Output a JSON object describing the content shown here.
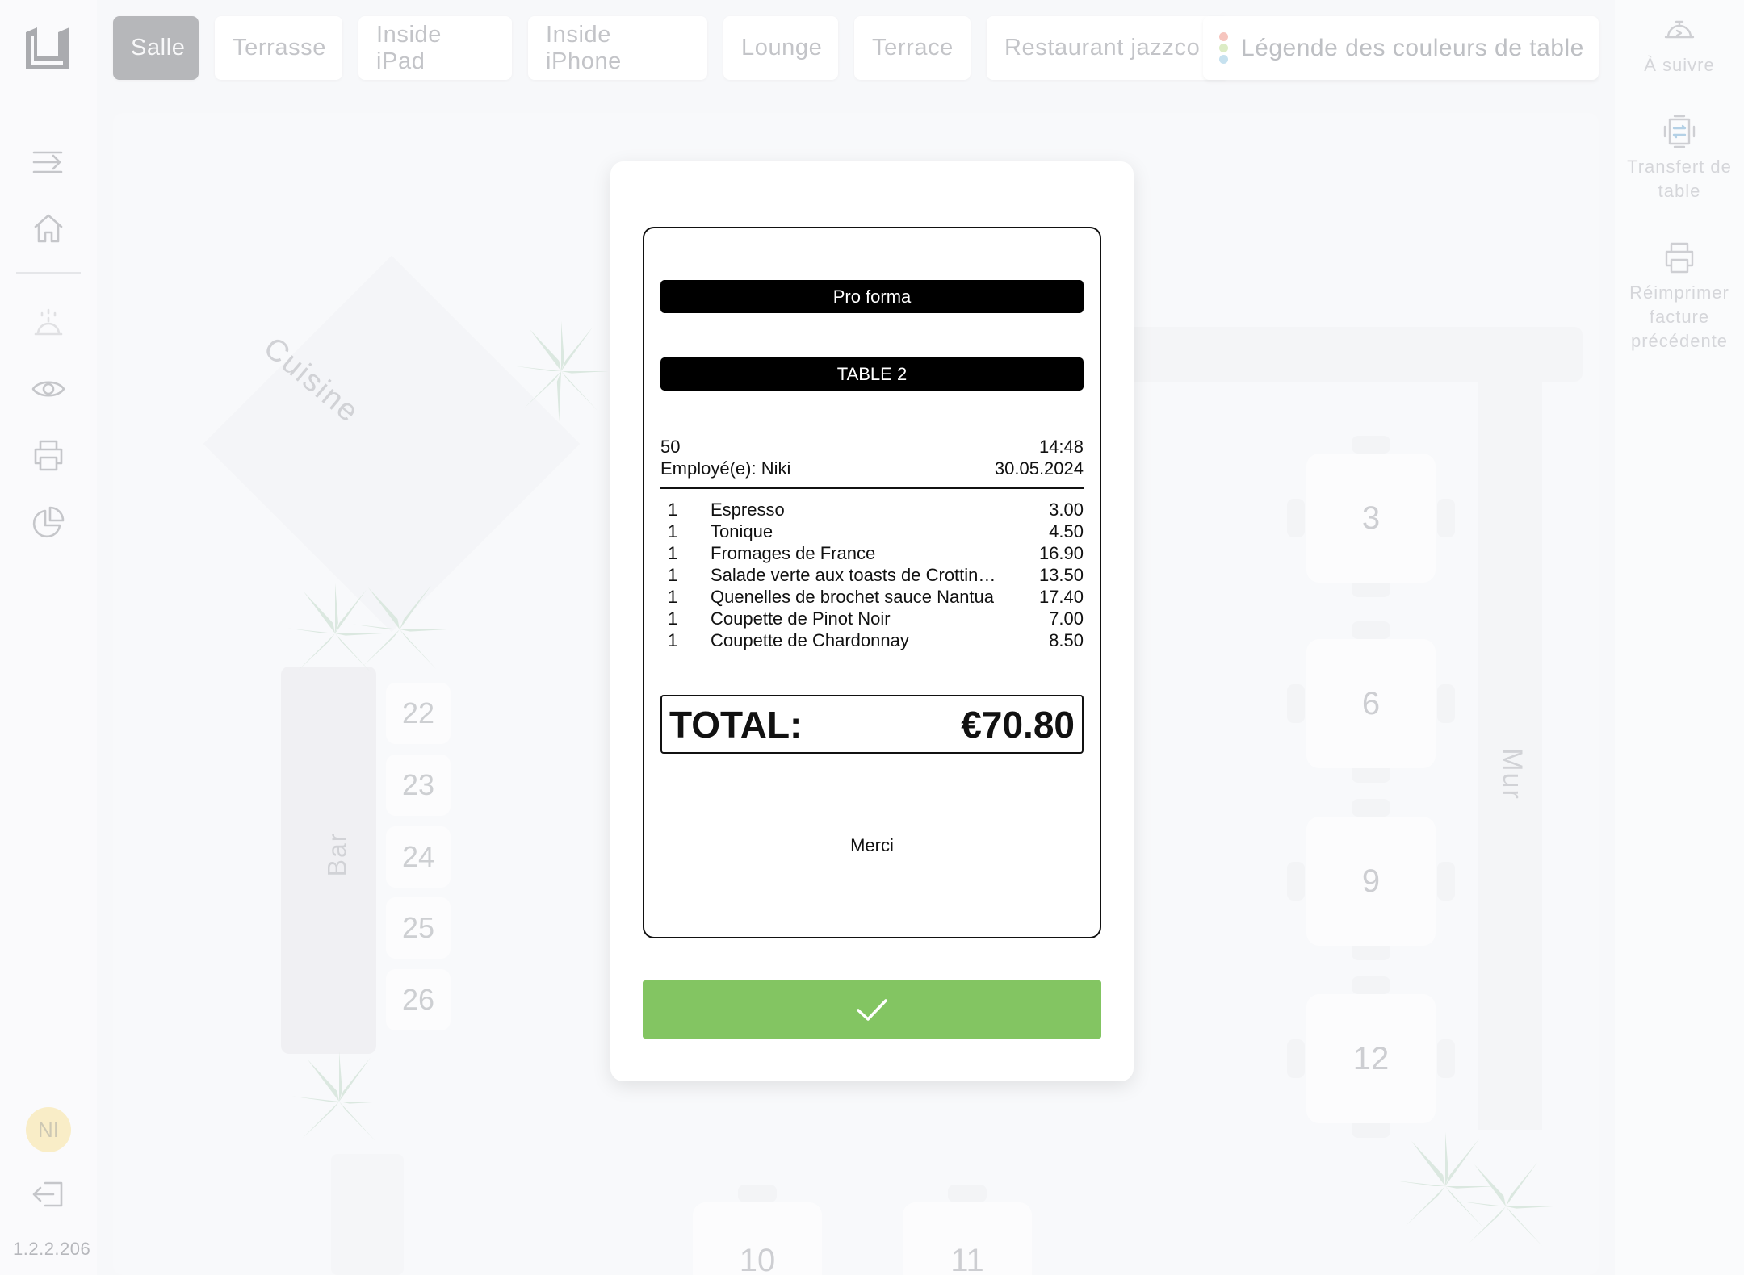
{
  "sidebar": {
    "version": "1.2.2.206",
    "avatar_initials": "NI",
    "icons": [
      "logo-icon",
      "collapse-menu-icon",
      "home-icon",
      "service-bell-icon",
      "eye-icon",
      "printer-icon",
      "pie-chart-icon",
      "logout-icon"
    ]
  },
  "tabs": [
    {
      "label": "Salle",
      "active": true
    },
    {
      "label": "Terrasse",
      "active": false
    },
    {
      "label": "Inside iPad",
      "active": false
    },
    {
      "label": "Inside iPhone",
      "active": false
    },
    {
      "label": "Lounge",
      "active": false
    },
    {
      "label": "Terrace",
      "active": false
    },
    {
      "label": "Restaurant jazzco",
      "active": false
    }
  ],
  "legend": {
    "label": "Légende des couleurs de table",
    "dot_colors": [
      "#f2a79c",
      "#c9e2a6",
      "#a8d2e6"
    ]
  },
  "right_actions": [
    {
      "label": "À suivre",
      "icon": "service-bell-arrow-icon"
    },
    {
      "label": "Transfert de table",
      "icon": "table-transfer-icon"
    },
    {
      "label": "Réimprimer facture précédente",
      "icon": "printer-icon"
    }
  ],
  "floor": {
    "kitchen_label": "Cuisine",
    "bar_label": "Bar",
    "wall_label": "Mur",
    "stools": [
      "22",
      "23",
      "24",
      "25",
      "26"
    ],
    "tables": [
      "3",
      "6",
      "9",
      "12"
    ],
    "bottom_tables": [
      "10",
      "11"
    ]
  },
  "receipt": {
    "title": "Pro forma",
    "table": "TABLE 2",
    "number": "50",
    "time": "14:48",
    "employee": "Employé(e): Niki",
    "date": "30.05.2024",
    "items": [
      {
        "qty": "1",
        "name": "Espresso",
        "price": "3.00"
      },
      {
        "qty": "1",
        "name": "Tonique",
        "price": "4.50"
      },
      {
        "qty": "1",
        "name": "Fromages de France",
        "price": "16.90"
      },
      {
        "qty": "1",
        "name": "Salade verte aux toasts de Crottin de Chavignol",
        "price": "13.50"
      },
      {
        "qty": "1",
        "name": "Quenelles de brochet sauce Nantua",
        "price": "17.40"
      },
      {
        "qty": "1",
        "name": "Coupette de Pinot Noir",
        "price": "7.00"
      },
      {
        "qty": "1",
        "name": "Coupette de Chardonnay",
        "price": "8.50"
      }
    ],
    "total_label": "TOTAL:",
    "total_value": "€70.80",
    "footer": "Merci"
  },
  "confirm_icon": "checkmark-icon",
  "colors": {
    "accent_green": "#83c562",
    "active_tab": "#8f9196",
    "avatar_bg": "#f6e3a9"
  }
}
